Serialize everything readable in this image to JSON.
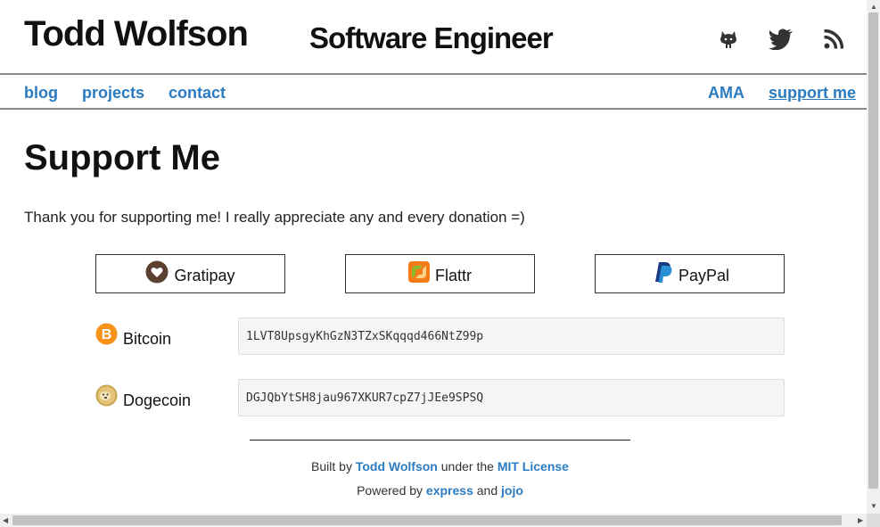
{
  "header": {
    "site_name": "Todd Wolfson",
    "tagline": "Software Engineer",
    "social_icons": [
      "github-icon",
      "twitter-icon",
      "rss-icon"
    ]
  },
  "nav": {
    "left": [
      "blog",
      "projects",
      "contact"
    ],
    "right": [
      "AMA",
      "support me"
    ],
    "active": "support me"
  },
  "main": {
    "title": "Support Me",
    "intro": "Thank you for supporting me! I really appreciate any and every donation =)",
    "donate_buttons": [
      {
        "label": "Gratipay",
        "icon": "gratipay-icon"
      },
      {
        "label": "Flattr",
        "icon": "flattr-icon"
      },
      {
        "label": "PayPal",
        "icon": "paypal-icon"
      }
    ],
    "coins": [
      {
        "label": "Bitcoin",
        "icon": "bitcoin-icon",
        "address": "1LVT8UpsgyKhGzN3TZxSKqqqd466NtZ99p"
      },
      {
        "label": "Dogecoin",
        "icon": "dogecoin-icon",
        "address": "DGJQbYtSH8jau967XKUR7cpZ7jJEe9SPSQ"
      }
    ]
  },
  "footer": {
    "built_by_prefix": "Built by",
    "built_by_link": "Todd Wolfson",
    "under_the": "under the",
    "license_link": "MIT License",
    "powered_by_prefix": "Powered by",
    "express_link": "express",
    "and": "and",
    "jojo_link": "jojo"
  },
  "colors": {
    "link": "#2a7bc0",
    "divider": "#888888",
    "text": "#222222"
  }
}
